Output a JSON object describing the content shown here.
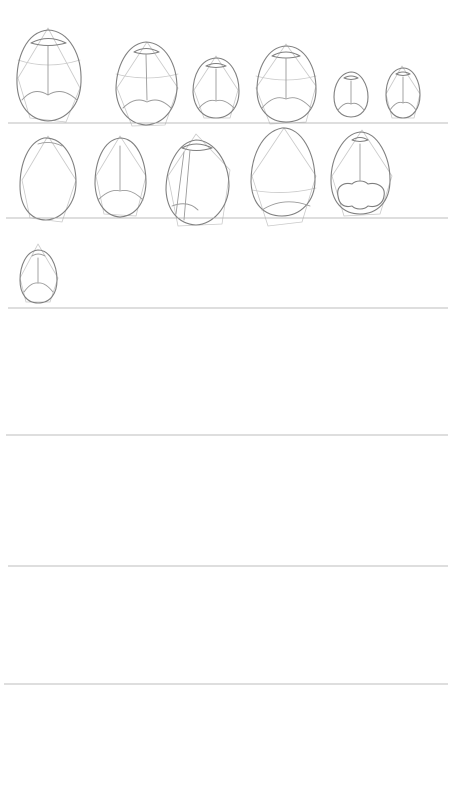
{
  "page": {
    "background_color": "#ffffff",
    "pencil_color": "#7f7f7f",
    "guide_color": "#c9c9c9",
    "rule_color": "#a9a9a9"
  },
  "sketch_rows": [
    {
      "sketch_count": 6
    },
    {
      "sketch_count": 5
    },
    {
      "sketch_count": 1
    }
  ],
  "empty_rows": 4
}
